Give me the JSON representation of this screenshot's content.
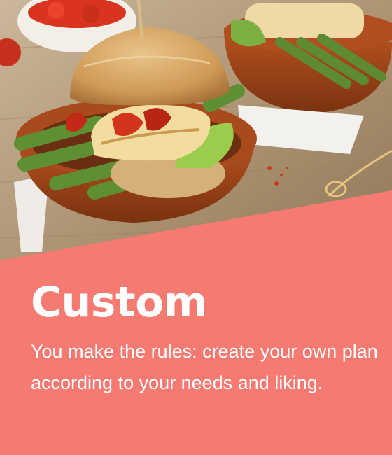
{
  "card": {
    "title": "Custom",
    "description": "You make the rules: create your own plan according to your needs and liking.",
    "accent_color": "#f47a72",
    "image_alt": "Halloumi burger with asparagus in a terracotta bowl"
  }
}
